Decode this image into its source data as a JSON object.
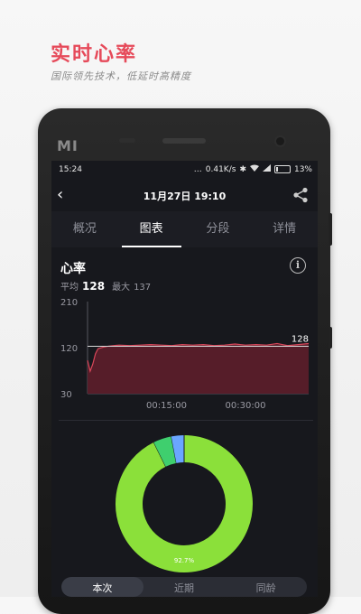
{
  "promo": {
    "headline": "实时心率",
    "subline": "国际领先技术，低延时高精度"
  },
  "device": {
    "brand": "MI"
  },
  "statusbar": {
    "time": "15:24",
    "network": "0.41K/s",
    "battery": "13%"
  },
  "appbar": {
    "title": "11月27日 19:10"
  },
  "tabs": [
    {
      "label": "概况",
      "active": false
    },
    {
      "label": "图表",
      "active": true
    },
    {
      "label": "分段",
      "active": false
    },
    {
      "label": "详情",
      "active": false
    }
  ],
  "heart_rate": {
    "title": "心率",
    "avg_label": "平均",
    "avg_value": "128",
    "max_label": "最大",
    "max_value": "137"
  },
  "bottom_tabs": [
    "本次",
    "近期",
    "同龄"
  ],
  "colors": {
    "accent": "#e64a5a",
    "line": "#d9475a",
    "area": "#5a1d2a",
    "donut_main": "#8be03a",
    "donut_a": "#3fcf6e",
    "donut_b": "#6aa6ff"
  },
  "chart_data": [
    {
      "type": "area",
      "title": "心率",
      "ylim": [
        30,
        210
      ],
      "yticks": [
        "210",
        "120",
        "30"
      ],
      "xticks": [
        "00:15:00",
        "00:30:00"
      ],
      "x_minutes": [
        0,
        0.5,
        1,
        1.5,
        2,
        3,
        4,
        5,
        6,
        8,
        10,
        12,
        14,
        16,
        18,
        20,
        22,
        24,
        26,
        28,
        30,
        32,
        34,
        36,
        38,
        40,
        42
      ],
      "y_bpm": [
        95,
        74,
        88,
        108,
        118,
        121,
        123,
        124,
        125,
        124,
        125,
        126,
        125,
        124,
        126,
        125,
        126,
        124,
        125,
        127,
        125,
        126,
        125,
        128,
        124,
        126,
        128
      ],
      "reference_line": "128"
    },
    {
      "type": "pie",
      "slices": [
        {
          "value": 92.7,
          "color": "#8be03a",
          "label": "92.7%"
        },
        {
          "value": 4.3,
          "color": "#3fcf6e",
          "label": ""
        },
        {
          "value": 3.0,
          "color": "#6aa6ff",
          "label": ""
        }
      ]
    }
  ]
}
